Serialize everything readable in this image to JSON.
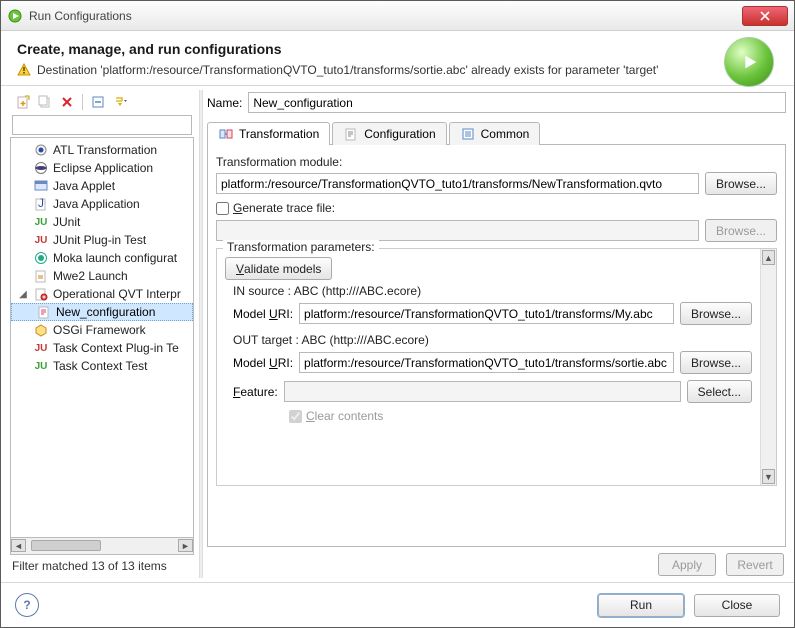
{
  "window": {
    "title": "Run Configurations"
  },
  "header": {
    "heading": "Create, manage, and run configurations",
    "warning": "Destination 'platform:/resource/TransformationQVTO_tuto1/transforms/sortie.abc' already exists for parameter 'target'"
  },
  "left": {
    "filter_value": "",
    "items": [
      {
        "label": "ATL Transformation"
      },
      {
        "label": "Eclipse Application"
      },
      {
        "label": "Java Applet"
      },
      {
        "label": "Java Application"
      },
      {
        "label": "JUnit"
      },
      {
        "label": "JUnit Plug-in Test"
      },
      {
        "label": "Moka launch configurat"
      },
      {
        "label": "Mwe2 Launch"
      },
      {
        "label": "Operational QVT Interpr",
        "expanded": true,
        "children": [
          {
            "label": "New_configuration",
            "selected": true
          }
        ]
      },
      {
        "label": "OSGi Framework"
      },
      {
        "label": "Task Context Plug-in Te"
      },
      {
        "label": "Task Context Test"
      }
    ],
    "filter_status": "Filter matched 13 of 13 items"
  },
  "right": {
    "name_label": "Name:",
    "name_value": "New_configuration",
    "tabs": [
      {
        "label": "Transformation",
        "active": true
      },
      {
        "label": "Configuration"
      },
      {
        "label": "Common"
      }
    ],
    "module_label": "Transformation module:",
    "module_value": "platform:/resource/TransformationQVTO_tuto1/transforms/NewTransformation.qvto",
    "browse_label": "Browse...",
    "trace_label": "Generate trace file:",
    "params_label": "Transformation parameters:",
    "validate_label": "Validate models",
    "in_head": "IN  source : ABC (http:///ABC.ecore)",
    "out_head": "OUT  target : ABC (http:///ABC.ecore)",
    "model_uri_label_1": "Model URI:",
    "model_uri_label_2": "Model URI:",
    "in_uri": "platform:/resource/TransformationQVTO_tuto1/transforms/My.abc",
    "out_uri": "platform:/resource/TransformationQVTO_tuto1/transforms/sortie.abc",
    "feature_label": "Feature:",
    "feature_value": "",
    "select_label": "Select...",
    "clear_label": "Clear contents",
    "apply_label": "Apply",
    "revert_label": "Revert"
  },
  "footer": {
    "run_label": "Run",
    "close_label": "Close"
  }
}
